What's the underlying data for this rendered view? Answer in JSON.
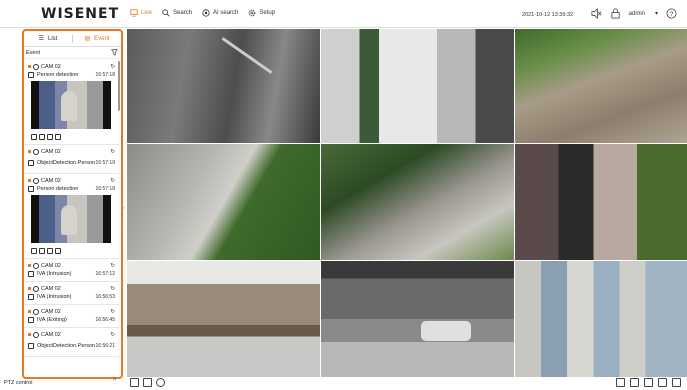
{
  "header": {
    "logo": "WISENET",
    "nav": [
      {
        "label": "Live",
        "icon": "live-icon",
        "active": true
      },
      {
        "label": "Search",
        "icon": "search-icon",
        "active": false
      },
      {
        "label": "AI search",
        "icon": "ai-search-icon",
        "active": false
      },
      {
        "label": "Setup",
        "icon": "gear-icon",
        "active": false
      }
    ],
    "datetime": "2021-10-12 13:39:32",
    "user": "admin"
  },
  "panel": {
    "tabs": [
      {
        "label": "List",
        "active": false
      },
      {
        "label": "Event",
        "active": true
      }
    ],
    "section_label": "Event",
    "events": [
      {
        "camera": "CAM 02",
        "type": "Person detection",
        "time": "16:57:18",
        "has_thumb": true
      },
      {
        "camera": "CAM 02",
        "type": "ObjectDetection.Person",
        "time": "16:57:19",
        "has_thumb": false
      },
      {
        "camera": "CAM 02",
        "type": "Person detection",
        "time": "16:57:18",
        "has_thumb": true
      },
      {
        "camera": "CAM 02",
        "type": "IVA (Intrusion)",
        "time": "16:57:12",
        "has_thumb": false
      },
      {
        "camera": "CAM 02",
        "type": "IVA (Intrusion)",
        "time": "16:56:53",
        "has_thumb": false
      },
      {
        "camera": "CAM 02",
        "type": "IVA (Exiting)",
        "time": "16:56:45",
        "has_thumb": false
      },
      {
        "camera": "CAM 02",
        "type": "ObjectDetection.Person",
        "time": "16:56:21",
        "has_thumb": false
      }
    ]
  },
  "footer": {
    "ptz_label": "PTZ control"
  },
  "colors": {
    "accent": "#e87722"
  }
}
